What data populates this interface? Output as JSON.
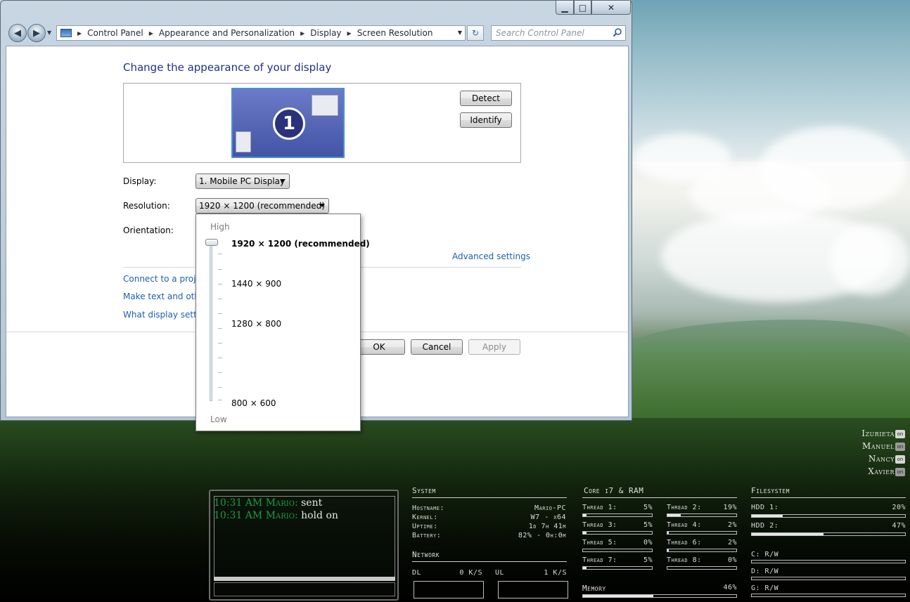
{
  "window": {
    "breadcrumb": [
      "Control Panel",
      "Appearance and Personalization",
      "Display",
      "Screen Resolution"
    ],
    "search_placeholder": "Search Control Panel",
    "caption": {
      "minimize": "▁",
      "maximize": "□",
      "close": "✕"
    }
  },
  "page": {
    "title": "Change the appearance of your display",
    "monitor_number": "1",
    "detect_label": "Detect",
    "identify_label": "Identify",
    "display_label": "Display:",
    "display_value": "1. Mobile PC Display",
    "resolution_label": "Resolution:",
    "resolution_value": "1920 × 1200 (recommended)",
    "orientation_label": "Orientation:",
    "advanced_settings": "Advanced settings",
    "links": [
      "Connect to a projec",
      "Make text and other",
      "What display setting"
    ],
    "ok_label": "OK",
    "cancel_label": "Cancel",
    "apply_label": "Apply"
  },
  "resolution_popup": {
    "high_label": "High",
    "low_label": "Low",
    "options": [
      "1920 × 1200 (recommended)",
      "1440 × 900",
      "1280 × 800",
      "800 × 600"
    ],
    "selected_index": 0
  },
  "chat": {
    "messages": [
      {
        "time": "10:31 AM",
        "sender": "Mario:",
        "text": "sent"
      },
      {
        "time": "10:31 AM",
        "sender": "Mario:",
        "text": "hold on"
      }
    ]
  },
  "users": [
    {
      "name": "Izurieta",
      "status": "on"
    },
    {
      "name": "Manuel",
      "status": "on"
    },
    {
      "name": "Nancy",
      "status": "on"
    },
    {
      "name": "Xavier",
      "status": "on"
    }
  ],
  "system": {
    "title": "System",
    "hostname_label": "Hostname:",
    "hostname": "Mario-PC",
    "kernel_label": "Kernel:",
    "kernel": "W7 - x64",
    "uptime_label": "Uptime:",
    "uptime": "1d 7h 41m",
    "battery_label": "Battery:",
    "battery": "82% - 0h:0m",
    "network_title": "Network",
    "dl_label": "DL",
    "dl_value": "0 K/S",
    "ul_label": "UL",
    "ul_value": "1 K/S"
  },
  "cpu": {
    "title": "Core i7 & RAM",
    "threads": [
      {
        "label": "Thread 1:",
        "value": "5%",
        "percent": 5
      },
      {
        "label": "Thread 2:",
        "value": "19%",
        "percent": 19
      },
      {
        "label": "Thread 3:",
        "value": "5%",
        "percent": 5
      },
      {
        "label": "Thread 4:",
        "value": "2%",
        "percent": 2
      },
      {
        "label": "Thread 5:",
        "value": "0%",
        "percent": 0
      },
      {
        "label": "Thread 6:",
        "value": "2%",
        "percent": 2
      },
      {
        "label": "Thread 7:",
        "value": "5%",
        "percent": 5
      },
      {
        "label": "Thread 8:",
        "value": "0%",
        "percent": 0
      }
    ],
    "memory_label": "Memory",
    "memory_value": "46%",
    "memory_percent": 46
  },
  "filesystem": {
    "title": "Filesystem",
    "hdd1_label": "HDD 1:",
    "hdd1_value": "20%",
    "hdd1_percent": 20,
    "hdd2_label": "HDD 2:",
    "hdd2_value": "47%",
    "hdd2_percent": 47,
    "drives": [
      "C: R/W",
      "D: R/W",
      "G: R/W"
    ]
  }
}
